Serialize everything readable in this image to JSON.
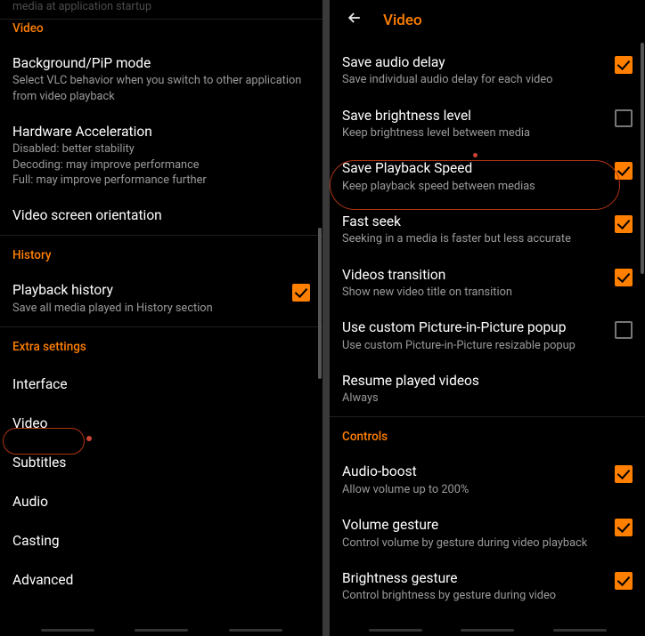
{
  "left": {
    "truncated_top": "media at application startup",
    "sections": {
      "video": {
        "header": "Video",
        "items": [
          {
            "key": "bg-pip",
            "label": "Background/PiP mode",
            "sub": "Select VLC behavior when you switch to other application from video playback"
          },
          {
            "key": "hw-accel",
            "label": "Hardware Acceleration",
            "sub": "Disabled: better stability\nDecoding: may improve performance\nFull: may improve performance further"
          },
          {
            "key": "orientation",
            "label": "Video screen orientation",
            "sub": ""
          }
        ]
      },
      "history": {
        "header": "History",
        "items": [
          {
            "key": "playback-history",
            "label": "Playback history",
            "sub": "Save all media played in History section",
            "checked": true
          }
        ]
      },
      "extra": {
        "header": "Extra settings",
        "items": [
          {
            "key": "interface",
            "label": "Interface"
          },
          {
            "key": "video",
            "label": "Video"
          },
          {
            "key": "subtitles",
            "label": "Subtitles"
          },
          {
            "key": "audio",
            "label": "Audio"
          },
          {
            "key": "casting",
            "label": "Casting"
          },
          {
            "key": "advanced",
            "label": "Advanced"
          }
        ]
      }
    }
  },
  "right": {
    "title": "Video",
    "items": [
      {
        "key": "save-audio-delay",
        "label": "Save audio delay",
        "sub": "Save individual audio delay for each video",
        "checked": true
      },
      {
        "key": "save-brightness",
        "label": "Save brightness level",
        "sub": "Keep brightness level between media",
        "checked": false
      },
      {
        "key": "save-playback-speed",
        "label": "Save Playback Speed",
        "sub": "Keep playback speed between medias",
        "checked": true
      },
      {
        "key": "fast-seek",
        "label": "Fast seek",
        "sub": "Seeking in a media is faster but less accurate",
        "checked": true
      },
      {
        "key": "videos-transition",
        "label": "Videos transition",
        "sub": "Show new video title on transition",
        "checked": true
      },
      {
        "key": "use-pip-popup",
        "label": "Use custom Picture-in-Picture popup",
        "sub": "Use custom Picture-in-Picture resizable popup",
        "checked": false
      },
      {
        "key": "resume-played",
        "label": "Resume played videos",
        "sub": "Always"
      }
    ],
    "controls_header": "Controls",
    "controls": [
      {
        "key": "audio-boost",
        "label": "Audio-boost",
        "sub": "Allow volume up to 200%",
        "checked": true
      },
      {
        "key": "volume-gesture",
        "label": "Volume gesture",
        "sub": "Control volume by gesture during video playback",
        "checked": true
      },
      {
        "key": "brightness-gesture",
        "label": "Brightness gesture",
        "sub": "Control brightness by gesture during video",
        "checked": true
      }
    ]
  }
}
